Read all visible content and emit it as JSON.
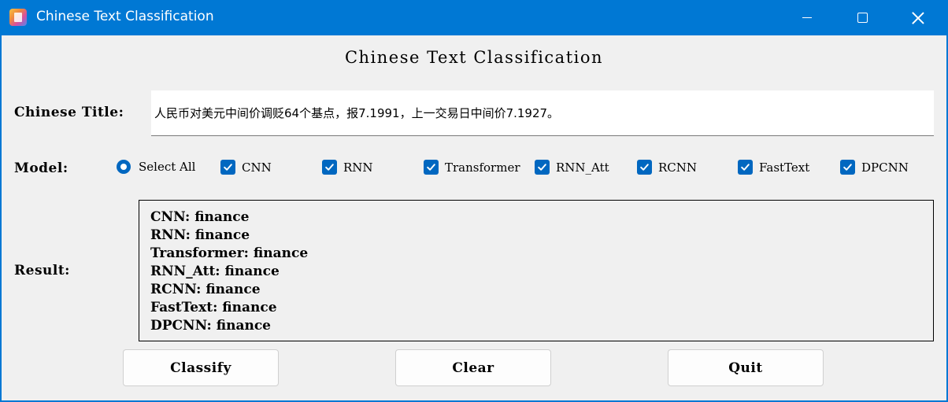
{
  "window": {
    "title": "Chinese Text Classification",
    "accent": "#0078d4"
  },
  "heading": "Chinese Text Classification",
  "form": {
    "title_label": "Chinese Title:",
    "title_value": "人民币对美元中间价调贬64个基点，报7.1991，上一交易日中间价7.1927。",
    "model_label": "Model:",
    "select_all": {
      "label": "Select All",
      "selected": true
    },
    "models": [
      {
        "label": "CNN",
        "checked": true
      },
      {
        "label": "RNN",
        "checked": true
      },
      {
        "label": "Transformer",
        "checked": true
      },
      {
        "label": "RNN_Att",
        "checked": true
      },
      {
        "label": "RCNN",
        "checked": true
      },
      {
        "label": "FastText",
        "checked": true
      },
      {
        "label": "DPCNN",
        "checked": true
      }
    ],
    "result_label": "Result:"
  },
  "results": [
    "CNN: finance",
    "RNN: finance",
    "Transformer: finance",
    "RNN_Att: finance",
    "RCNN: finance",
    "FastText: finance",
    "DPCNN: finance"
  ],
  "buttons": {
    "classify": "Classify",
    "clear": "Clear",
    "quit": "Quit"
  },
  "icons": {
    "app": "app-logo-icon",
    "minimize": "minimize-icon",
    "maximize": "maximize-icon",
    "close": "close-icon",
    "check": "checkmark-icon"
  }
}
